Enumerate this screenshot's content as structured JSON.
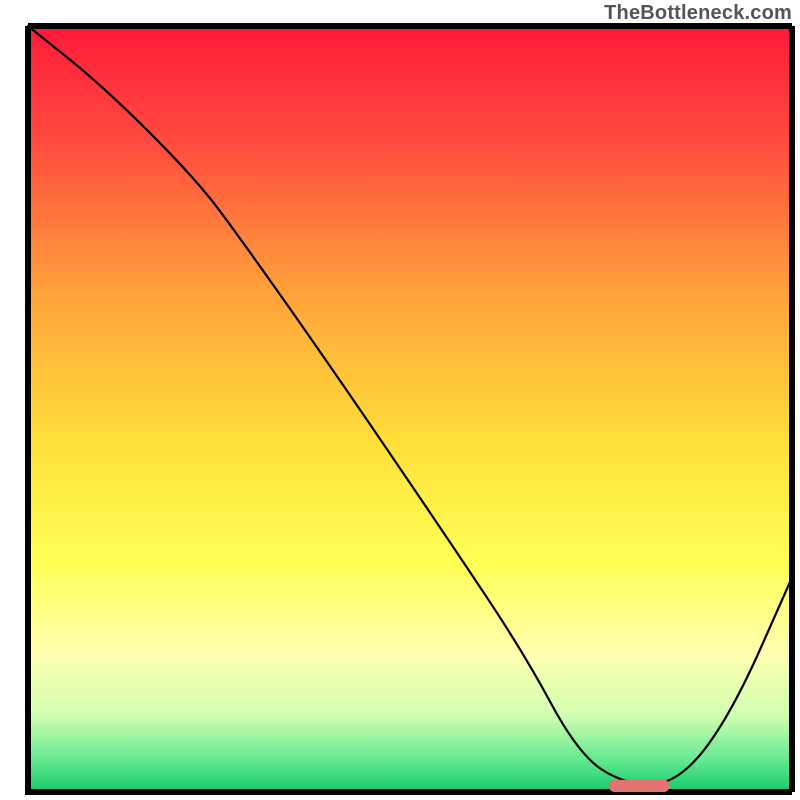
{
  "watermark": "TheBottleneck.com",
  "chart_data": {
    "type": "line",
    "title": "",
    "xlabel": "",
    "ylabel": "",
    "xlim": [
      0,
      100
    ],
    "ylim": [
      0,
      100
    ],
    "grid": false,
    "legend": false,
    "background_gradient": {
      "stops": [
        {
          "offset": 0.0,
          "color": "#ff1a3a"
        },
        {
          "offset": 0.15,
          "color": "#ff4a3f"
        },
        {
          "offset": 0.35,
          "color": "#ffa33a"
        },
        {
          "offset": 0.55,
          "color": "#ffe13a"
        },
        {
          "offset": 0.7,
          "color": "#ffff55"
        },
        {
          "offset": 0.82,
          "color": "#ffffb0"
        },
        {
          "offset": 0.9,
          "color": "#d0ffb0"
        },
        {
          "offset": 0.96,
          "color": "#60e890"
        },
        {
          "offset": 1.0,
          "color": "#15c96a"
        }
      ]
    },
    "series": [
      {
        "name": "bottleneck-curve",
        "color": "#000000",
        "width": 2.2,
        "x": [
          0,
          10,
          22,
          28,
          40,
          55,
          65,
          72,
          78,
          85,
          92,
          100
        ],
        "y": [
          100,
          92,
          80,
          72,
          55,
          33,
          18,
          5,
          1,
          1,
          10,
          28
        ]
      }
    ],
    "marker": {
      "name": "optimal-range",
      "color": "#e4736f",
      "x_start": 76,
      "x_end": 84,
      "y": 0.8,
      "thickness": 1.6
    }
  }
}
